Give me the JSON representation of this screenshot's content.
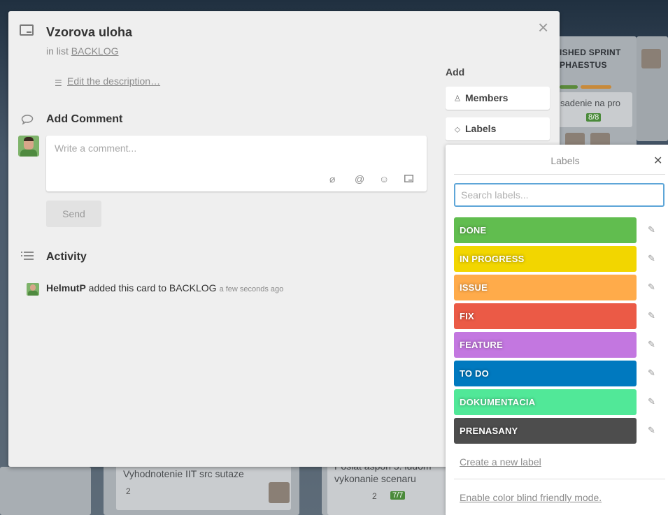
{
  "card": {
    "title": "Vzorova uloha",
    "in_list_prefix": "in list ",
    "list_name": "BACKLOG",
    "edit_description": "Edit the description…"
  },
  "comment": {
    "heading": "Add Comment",
    "placeholder": "Write a comment...",
    "send_label": "Send",
    "icons": [
      "attachment-icon",
      "mention-icon",
      "emoji-icon",
      "card-icon"
    ]
  },
  "activity": {
    "heading": "Activity",
    "user": "HelmutP",
    "action": " added this card to BACKLOG",
    "time": "a few seconds ago"
  },
  "sidebar": {
    "heading": "Add",
    "members_label": "Members",
    "labels_label": "Labels"
  },
  "labels_popover": {
    "title": "Labels",
    "search_placeholder": "Search labels...",
    "labels": [
      {
        "name": "DONE",
        "color": "#61bd4f"
      },
      {
        "name": "IN PROGRESS",
        "color": "#f2d600"
      },
      {
        "name": "ISSUE",
        "color": "#ffab4a"
      },
      {
        "name": "FIX",
        "color": "#eb5a46"
      },
      {
        "name": "FEATURE",
        "color": "#c377e0"
      },
      {
        "name": "TO DO",
        "color": "#0079bf"
      },
      {
        "name": "DOKUMENTACIA",
        "color": "#51e898"
      },
      {
        "name": "PRENASANY",
        "color": "#4d4d4d"
      }
    ],
    "create_label": "Create a new label",
    "color_blind": "Enable color blind friendly mode."
  },
  "background": {
    "list_header_1": "ISHED SPRINT",
    "list_header_2": "PHAESTUS",
    "card_snippet": "sadenie na pro",
    "checklist_badge": "8/8",
    "card_bottom_1": "Vyhodnotenie IIT src sutaze",
    "card_bottom_1_comments": "2",
    "card_bottom_2_line1": "Poslat aspon 5. ludom",
    "card_bottom_2_line2": "vykonanie scenaru",
    "card_bottom_2_comments": "2",
    "card_bottom_2_badge": "7/7"
  }
}
